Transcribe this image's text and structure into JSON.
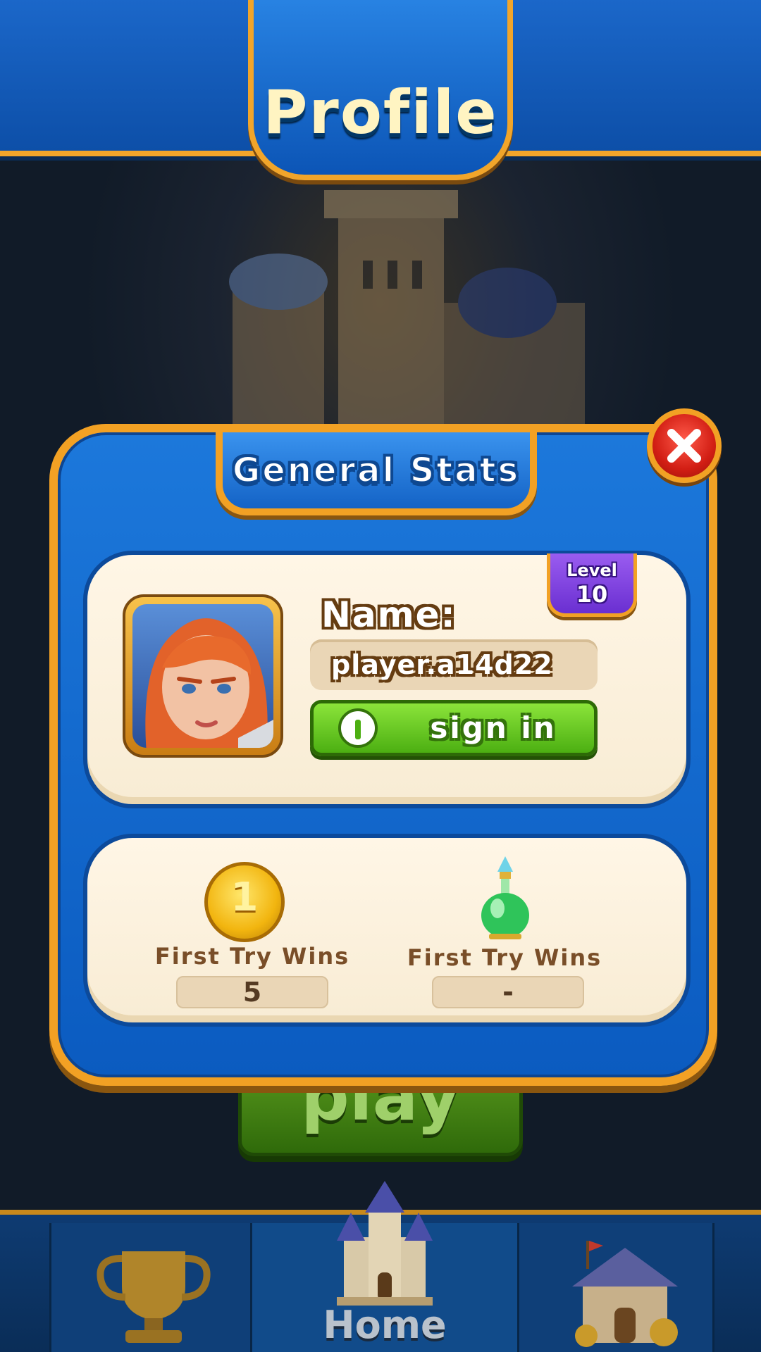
{
  "header": {
    "title": "Profile"
  },
  "panel": {
    "title": "General Stats",
    "close_icon": "close-icon"
  },
  "profile": {
    "level_label": "Level",
    "level_value": "10",
    "name_label": "Name:",
    "player_name": "player.a14d22",
    "signin_label": "sign in",
    "avatar_icon": "hero-portrait-avatar"
  },
  "stats": [
    {
      "icon": "gold-coin-icon",
      "coin_number": "1",
      "title": "First Try Wins",
      "value": "5"
    },
    {
      "icon": "green-potion-icon",
      "title": "First Try Wins",
      "value": "-"
    }
  ],
  "background": {
    "play_label": "play"
  },
  "bottom_nav": {
    "items": [
      {
        "icon": "trophy-icon"
      },
      {
        "icon": "castle-icon",
        "label": "Home"
      },
      {
        "icon": "shop-house-icon"
      }
    ]
  },
  "colors": {
    "title_fill_top": "#fffdbd",
    "title_fill_bottom": "#ffffff",
    "title_shadow": "#033766",
    "panel_title_stroke": "#0e4891",
    "level_stroke": "#361280",
    "name_stroke": "#653c11",
    "signin_stroke": "#34730b",
    "stat_title": "#794e28",
    "stat_value": "#543a22",
    "panel_border": "#f2a124"
  }
}
